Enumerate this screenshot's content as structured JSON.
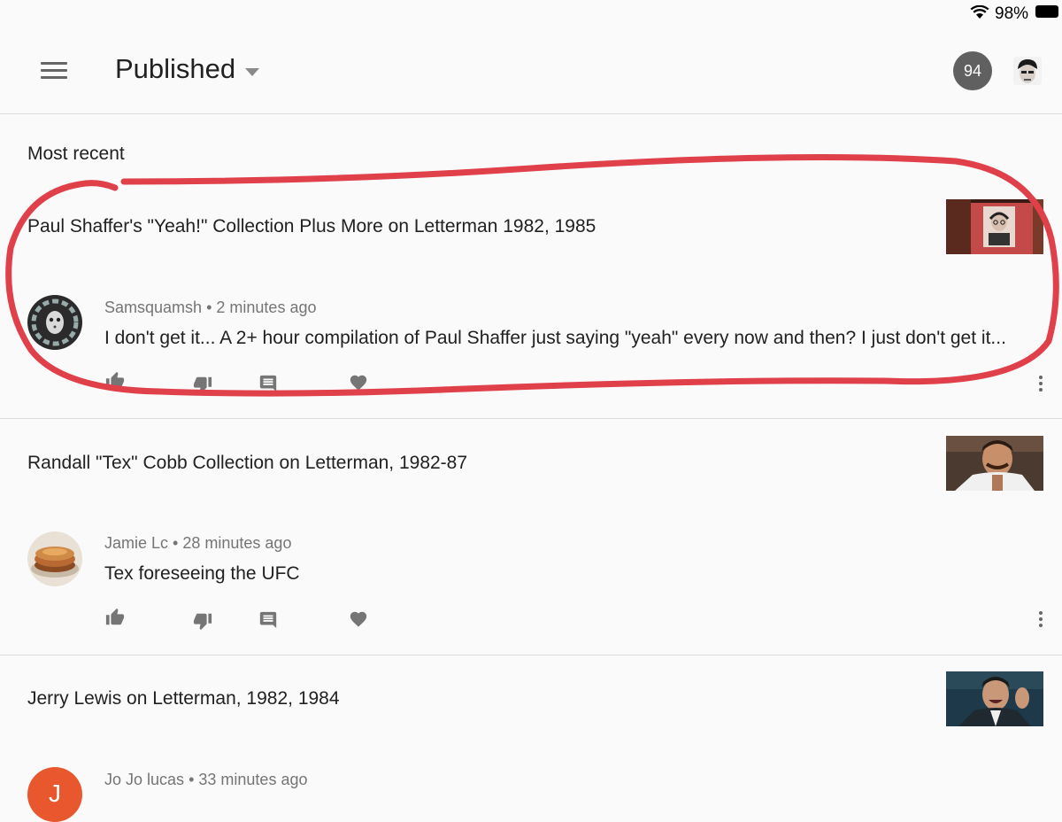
{
  "status_bar": {
    "battery": "98%"
  },
  "header": {
    "title": "Published",
    "notification_count": "94"
  },
  "section_label": "Most recent",
  "cards": [
    {
      "video_title": "Paul Shaffer's \"Yeah!\" Collection Plus More on Letterman 1982, 1985",
      "author": "Samsquamsh",
      "time": "2 minutes ago",
      "comment": "I don't get it... A 2+ hour compilation of Paul Shaffer just saying \"yeah\" every now and then? I just don't get it..."
    },
    {
      "video_title": "Randall \"Tex\" Cobb Collection on Letterman, 1982-87",
      "author": "Jamie Lc",
      "time": "28 minutes ago",
      "comment": "Tex foreseeing the UFC"
    },
    {
      "video_title": "Jerry Lewis on Letterman, 1982, 1984",
      "author": "Jo Jo lucas",
      "time": "33 minutes ago",
      "avatar_letter": "J"
    }
  ],
  "separator": "•",
  "colors": {
    "annotation": "#e0404a",
    "icon_gray": "#757575",
    "avatar_orange": "#e8572d"
  }
}
